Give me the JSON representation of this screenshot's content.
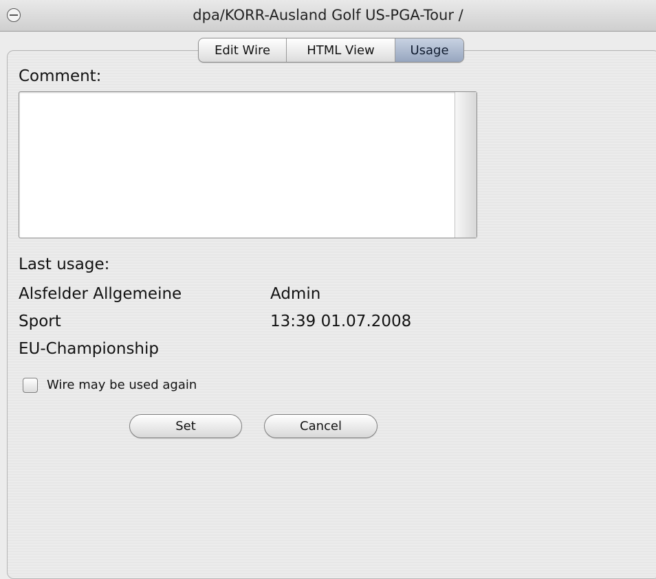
{
  "window": {
    "title": "dpa/KORR-Ausland Golf US-PGA-Tour /"
  },
  "tabs": [
    {
      "label": "Edit Wire"
    },
    {
      "label": "HTML View"
    },
    {
      "label": "Usage"
    }
  ],
  "comment": {
    "label": "Comment:",
    "value": ""
  },
  "last_usage": {
    "label": "Last usage:",
    "customer": "Alsfelder Allgemeine",
    "section": "Sport",
    "event": "EU-Championship",
    "user": "Admin",
    "timestamp": "13:39 01.07.2008"
  },
  "checkbox": {
    "label": "Wire may be used again",
    "checked": false
  },
  "buttons": {
    "set": "Set",
    "cancel": "Cancel"
  }
}
